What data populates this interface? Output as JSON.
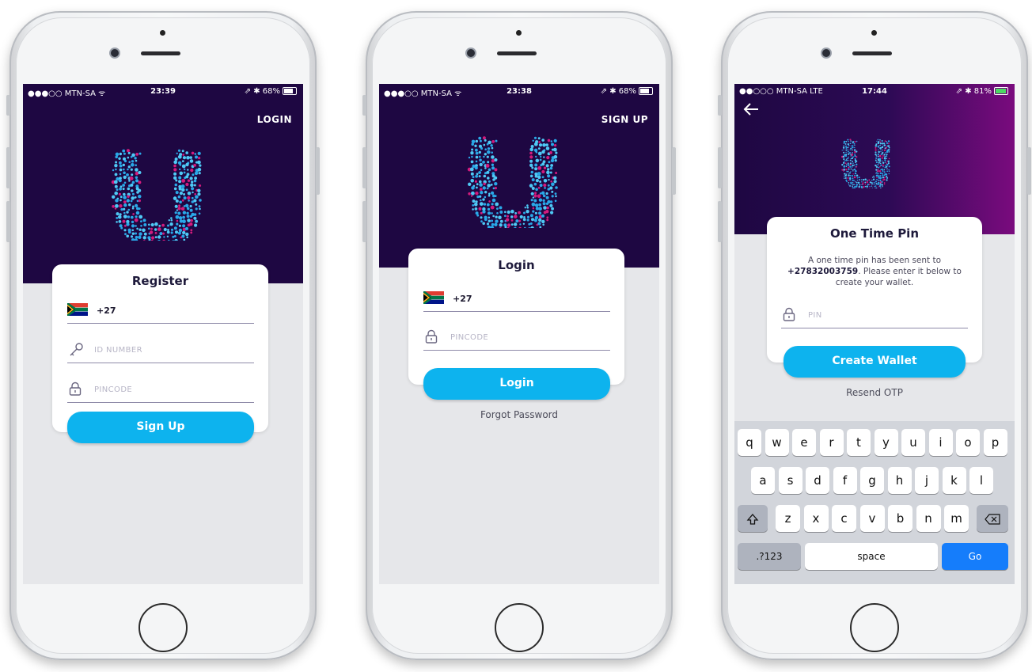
{
  "colors": {
    "hero": "#1e0742",
    "accent": "#0db3ee",
    "background": "#e6e7ea",
    "purple_glow": "#7a0b7e"
  },
  "phones": [
    {
      "status": {
        "carrier": "●●●○○ MTN-SA ᯤ",
        "time": "23:39",
        "battery": "⇗ ✱ 68%"
      },
      "top_link": "LOGIN",
      "card": {
        "title": "Register",
        "country_code": "+27",
        "fields": [
          "ID NUMBER",
          "PINCODE"
        ]
      },
      "button": "Sign Up"
    },
    {
      "status": {
        "carrier": "●●●○○ MTN-SA ᯤ",
        "time": "23:38",
        "battery": "⇗ ✱ 68%"
      },
      "top_link": "SIGN UP",
      "card": {
        "title": "Login",
        "country_code": "+27",
        "fields": [
          "PINCODE"
        ]
      },
      "button": "Login",
      "link": "Forgot Password"
    },
    {
      "status": {
        "carrier": "●●○○○ MTN-SA  LTE",
        "time": "17:44",
        "battery": "⇗ ✱ 81%"
      },
      "card": {
        "title": "One Time Pin",
        "message_before": "A one time pin has been sent to",
        "phone_number": "+27832003759",
        "message_after": ". Please enter it below to create your wallet.",
        "fields": [
          "PIN"
        ]
      },
      "button": "Create Wallet",
      "link": "Resend OTP",
      "keyboard": {
        "row1": [
          "q",
          "w",
          "e",
          "r",
          "t",
          "y",
          "u",
          "i",
          "o",
          "p"
        ],
        "row2": [
          "a",
          "s",
          "d",
          "f",
          "g",
          "h",
          "j",
          "k",
          "l"
        ],
        "row3": [
          "z",
          "x",
          "c",
          "v",
          "b",
          "n",
          "m"
        ],
        "numbers": ".?123",
        "space": "space",
        "go": "Go"
      }
    }
  ]
}
